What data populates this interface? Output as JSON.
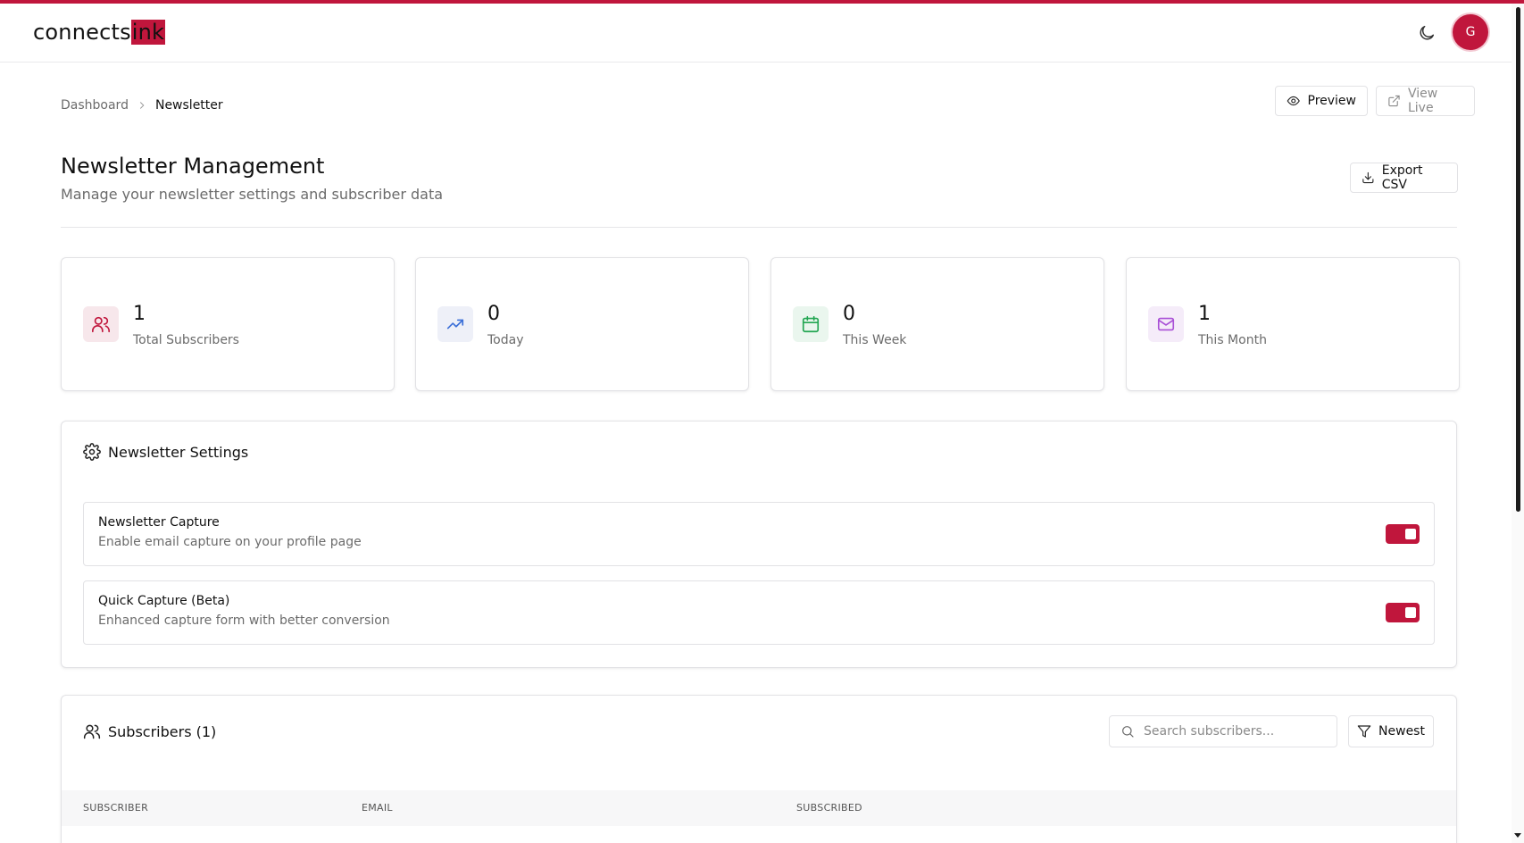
{
  "app": {
    "logo_text": "connects",
    "logo_highlight": "ink",
    "avatar_initial": "G",
    "accent_color": "#c0163c"
  },
  "breadcrumb": {
    "root": "Dashboard",
    "current": "Newsletter"
  },
  "actions": {
    "preview_label": "Preview",
    "view_live_label": "View Live",
    "export_label": "Export CSV"
  },
  "page": {
    "title": "Newsletter Management",
    "subtitle": "Manage your newsletter settings and subscriber data"
  },
  "stats": [
    {
      "value": "1",
      "label": "Total Subscribers",
      "icon": "users-icon",
      "color": "#c0163c"
    },
    {
      "value": "0",
      "label": "Today",
      "icon": "trending-up-icon",
      "color": "#3b6fd8"
    },
    {
      "value": "0",
      "label": "This Week",
      "icon": "calendar-icon",
      "color": "#22a652"
    },
    {
      "value": "1",
      "label": "This Month",
      "icon": "mail-icon",
      "color": "#a94fd6"
    }
  ],
  "settings": {
    "title": "Newsletter Settings",
    "items": [
      {
        "title": "Newsletter Capture",
        "description": "Enable email capture on your profile page",
        "enabled": true
      },
      {
        "title": "Quick Capture (Beta)",
        "description": "Enhanced capture form with better conversion",
        "enabled": true
      }
    ]
  },
  "subscribers": {
    "title": "Subscribers (1)",
    "search_placeholder": "Search subscribers...",
    "sort_label": "Newest",
    "columns": [
      "SUBSCRIBER",
      "EMAIL",
      "SUBSCRIBED"
    ]
  }
}
